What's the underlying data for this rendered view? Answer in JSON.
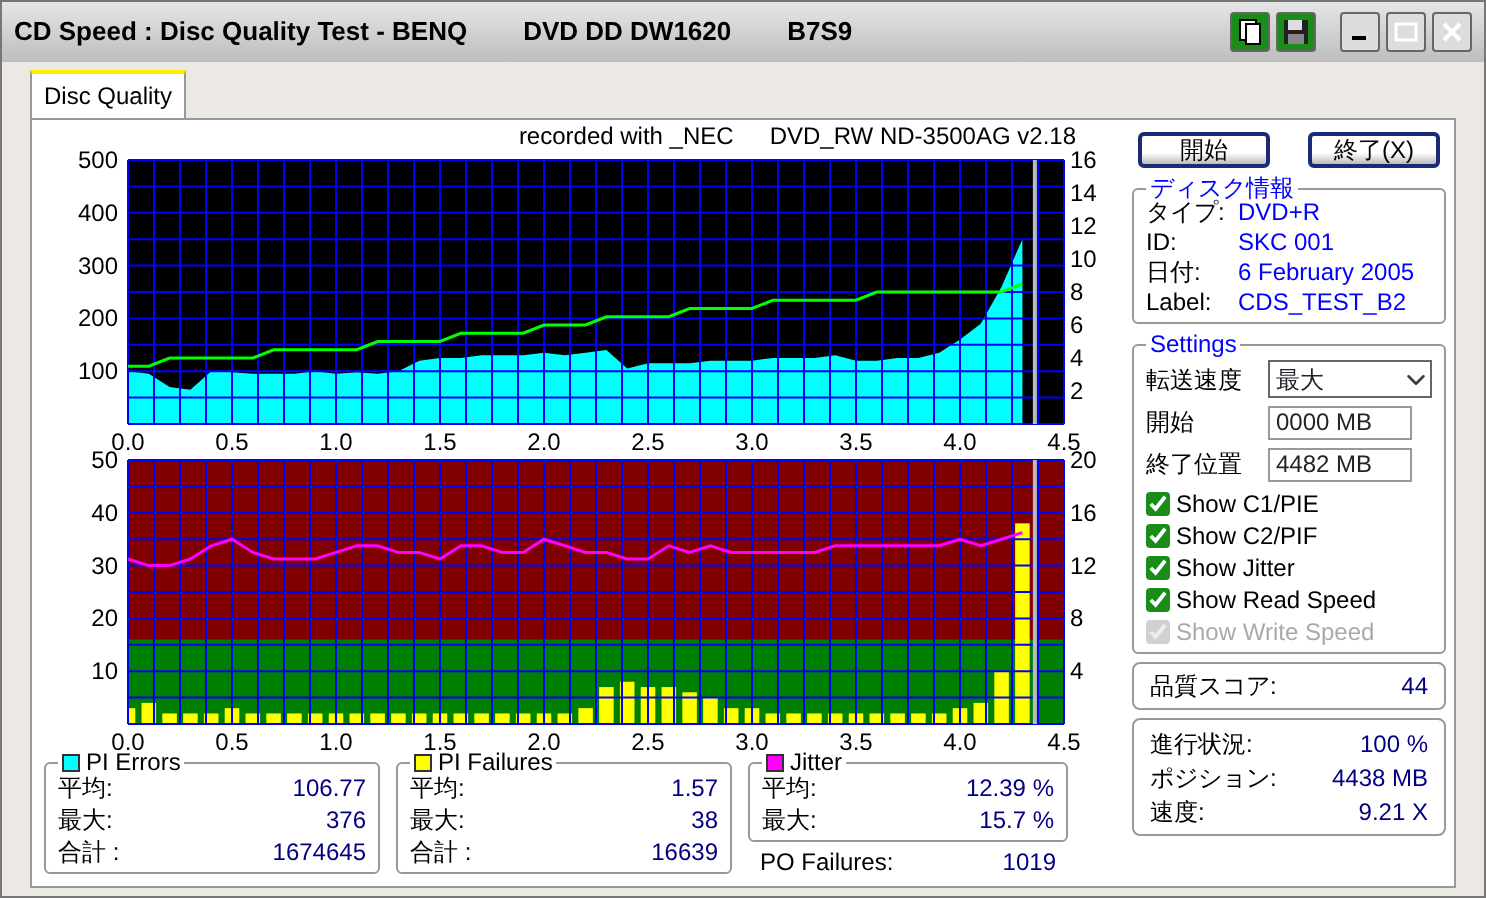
{
  "window": {
    "title_parts": [
      "CD Speed : Disc Quality Test - BENQ",
      "DVD DD DW1620",
      "B7S9"
    ]
  },
  "tabs": [
    {
      "label": "Disc Quality",
      "selected": true
    }
  ],
  "recorder": [
    "recorded with _NEC",
    "DVD_RW ND-3500AG v2.18"
  ],
  "charts": [
    {
      "chart_data": {
        "type": "area",
        "grid": true,
        "ref_lines": [
          {
            "axis": "x",
            "value": 4.36,
            "color": "#bbbbbb"
          }
        ],
        "xlim": [
          0,
          4.5
        ],
        "ylim": [
          0,
          500
        ],
        "y2lim": [
          0,
          16
        ],
        "xticks": [
          {
            "value": 0,
            "label": "0.0"
          },
          {
            "value": 0.5,
            "label": "0.5"
          },
          {
            "value": 1,
            "label": "1.0"
          },
          {
            "value": 1.5,
            "label": "1.5"
          },
          {
            "value": 2,
            "label": "2.0"
          },
          {
            "value": 2.5,
            "label": "2.5"
          },
          {
            "value": 3,
            "label": "3.0"
          },
          {
            "value": 3.5,
            "label": "3.5"
          },
          {
            "value": 4,
            "label": "4.0"
          },
          {
            "value": 4.5,
            "label": "4.5"
          }
        ],
        "yticks": [
          100,
          200,
          300,
          400,
          500
        ],
        "y2ticks": [
          2,
          4,
          6,
          8,
          10,
          12,
          14,
          16
        ],
        "x": [
          0,
          0.1,
          0.2,
          0.3,
          0.4,
          0.5,
          0.6,
          0.7,
          0.8,
          0.9,
          1,
          1.1,
          1.2,
          1.3,
          1.4,
          1.5,
          1.6,
          1.7,
          1.8,
          1.9,
          2,
          2.1,
          2.2,
          2.3,
          2.4,
          2.5,
          2.6,
          2.7,
          2.8,
          2.9,
          3,
          3.1,
          3.2,
          3.3,
          3.4,
          3.5,
          3.6,
          3.7,
          3.8,
          3.9,
          4,
          4.1,
          4.2,
          4.3
        ],
        "series": [
          {
            "color": "#00ffff",
            "values": [
              100,
              95,
              70,
              65,
              100,
              98,
              95,
              95,
              95,
              100,
              95,
              98,
              95,
              100,
              120,
              125,
              125,
              130,
              130,
              130,
              135,
              130,
              135,
              140,
              105,
              115,
              115,
              115,
              120,
              120,
              120,
              125,
              125,
              125,
              130,
              120,
              120,
              125,
              125,
              135,
              160,
              190,
              260,
              350
            ]
          },
          {
            "color": "#00ff00",
            "type": "line",
            "axis": "y2",
            "values": [
              3.5,
              3.5,
              4,
              4,
              4,
              4,
              4,
              4.5,
              4.5,
              4.5,
              4.5,
              4.5,
              5,
              5,
              5,
              5,
              5.5,
              5.5,
              5.5,
              5.5,
              6,
              6,
              6,
              6.5,
              6.5,
              6.5,
              6.5,
              7,
              7,
              7,
              7,
              7.5,
              7.5,
              7.5,
              7.5,
              7.5,
              8,
              8,
              8,
              8,
              8,
              8,
              8,
              8.5
            ]
          }
        ]
      }
    },
    {
      "chart_data": {
        "type": "bar",
        "grid": true,
        "ref_lines": [
          {
            "axis": "x",
            "value": 4.36,
            "color": "#bbbbbb"
          }
        ],
        "bands": [
          {
            "axis": "y",
            "from": 0,
            "to": 16,
            "color": "#008000"
          }
        ],
        "xlim": [
          0,
          4.5
        ],
        "ylim": [
          0,
          50
        ],
        "y2lim": [
          0,
          20
        ],
        "xticks": [
          {
            "value": 0,
            "label": "0.0"
          },
          {
            "value": 0.5,
            "label": "0.5"
          },
          {
            "value": 1,
            "label": "1.0"
          },
          {
            "value": 1.5,
            "label": "1.5"
          },
          {
            "value": 2,
            "label": "2.0"
          },
          {
            "value": 2.5,
            "label": "2.5"
          },
          {
            "value": 3,
            "label": "3.0"
          },
          {
            "value": 3.5,
            "label": "3.5"
          },
          {
            "value": 4,
            "label": "4.0"
          },
          {
            "value": 4.5,
            "label": "4.5"
          }
        ],
        "yticks": [
          10,
          20,
          30,
          40,
          50
        ],
        "y2ticks": [
          4,
          8,
          12,
          16,
          20
        ],
        "x": [
          0,
          0.1,
          0.2,
          0.3,
          0.4,
          0.5,
          0.6,
          0.7,
          0.8,
          0.9,
          1,
          1.1,
          1.2,
          1.3,
          1.4,
          1.5,
          1.6,
          1.7,
          1.8,
          1.9,
          2,
          2.1,
          2.2,
          2.3,
          2.4,
          2.5,
          2.6,
          2.7,
          2.8,
          2.9,
          3,
          3.1,
          3.2,
          3.3,
          3.4,
          3.5,
          3.6,
          3.7,
          3.8,
          3.9,
          4,
          4.1,
          4.2,
          4.3
        ],
        "series": [
          {
            "color": "#ffff00",
            "values": [
              3,
              4,
              2,
              2,
              2,
              3,
              2,
              2,
              2,
              2,
              2,
              2,
              2,
              2,
              2,
              2,
              2,
              2,
              2,
              2,
              2,
              2,
              3,
              7,
              8,
              7,
              7,
              6,
              5,
              3,
              3,
              2,
              2,
              2,
              2,
              2,
              2,
              2,
              2,
              2,
              3,
              4,
              10,
              38
            ]
          },
          {
            "color": "#ff00ff",
            "type": "line",
            "axis": "y2",
            "values": [
              12.5,
              12,
              12,
              12.5,
              13.5,
              14,
              13,
              12.5,
              12.5,
              12.5,
              13,
              13.5,
              13.5,
              13,
              13,
              12.5,
              13.5,
              13.5,
              13,
              13,
              14,
              13.5,
              13,
              13,
              12.5,
              12.5,
              13.5,
              13,
              13.5,
              13,
              13,
              13,
              13,
              13,
              13.5,
              13.5,
              13.5,
              13.5,
              13.5,
              13.5,
              14,
              13.5,
              14,
              14.5
            ]
          }
        ]
      }
    }
  ],
  "buttons": [
    {
      "label": "開始"
    },
    {
      "label": "終了(X)"
    }
  ],
  "disc_info": {
    "title": "ディスク情報",
    "rows": [
      {
        "label": "タイプ:",
        "value": "DVD+R"
      },
      {
        "label": "ID:",
        "value": "SKC 001"
      },
      {
        "label": "日付:",
        "value": "6 February 2005"
      },
      {
        "label": "Label:",
        "value": "CDS_TEST_B2"
      }
    ]
  },
  "settings": {
    "title": "Settings",
    "speed": {
      "label": "転送速度",
      "value": "最大"
    },
    "fields": [
      {
        "label": "開始",
        "value": "0000 MB"
      },
      {
        "label": "終了位置",
        "value": "4482 MB"
      }
    ],
    "options": [
      {
        "label": "Show C1/PIE",
        "checked": true,
        "disabled": false
      },
      {
        "label": "Show C2/PIF",
        "checked": true,
        "disabled": false
      },
      {
        "label": "Show Jitter",
        "checked": true,
        "disabled": false
      },
      {
        "label": "Show Read Speed",
        "checked": true,
        "disabled": false
      },
      {
        "label": "Show Write Speed",
        "checked": true,
        "disabled": true
      }
    ]
  },
  "score": {
    "label": "品質スコア:",
    "value": "44"
  },
  "progress": [
    {
      "label": "進行状況:",
      "value": "100 %"
    },
    {
      "label": "ポジション:",
      "value": "4438 MB"
    },
    {
      "label": "速度:",
      "value": "9.21 X"
    }
  ],
  "stats": [
    {
      "title": "PI Errors",
      "color": "#00ffff",
      "rows": [
        {
          "label": "平均:",
          "value": "106.77"
        },
        {
          "label": "最大:",
          "value": "376"
        },
        {
          "label": "合計 :",
          "value": "1674645"
        }
      ]
    },
    {
      "title": "PI Failures",
      "color": "#ffff00",
      "rows": [
        {
          "label": "平均:",
          "value": "1.57"
        },
        {
          "label": "最大:",
          "value": "38"
        },
        {
          "label": "合計 :",
          "value": "16639"
        }
      ]
    },
    {
      "title": "Jitter",
      "color": "#ff00ff",
      "rows": [
        {
          "label": "平均:",
          "value": "12.39 %"
        },
        {
          "label": "最大:",
          "value": "15.7 %"
        }
      ]
    }
  ],
  "po_failures": {
    "label": "PO Failures:",
    "value": "1019"
  }
}
